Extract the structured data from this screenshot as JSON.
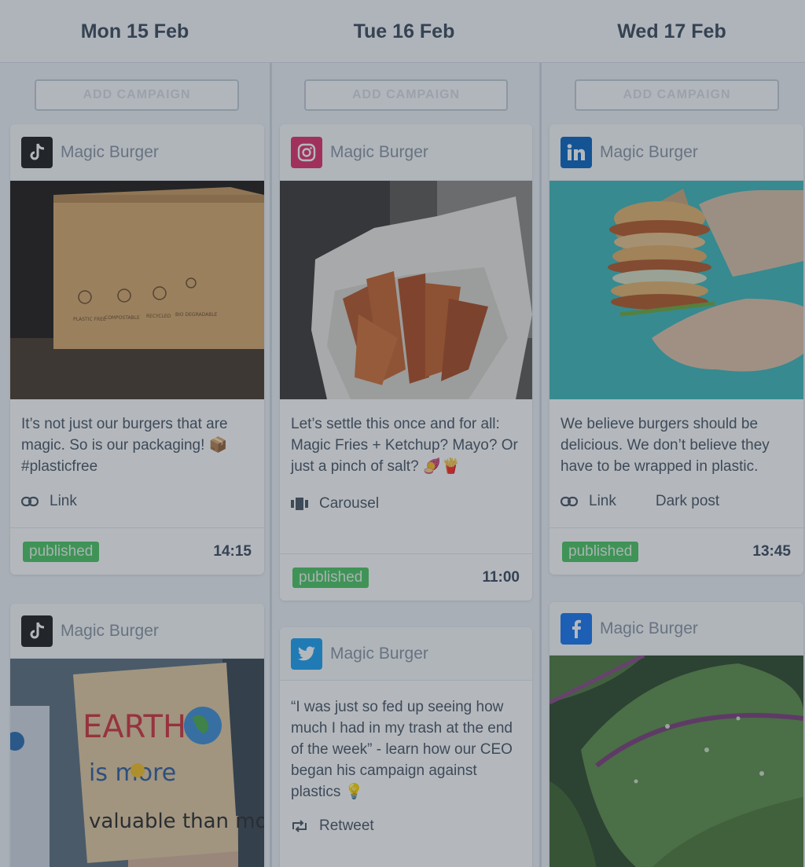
{
  "days": [
    "Mon 15 Feb",
    "Tue 16 Feb",
    "Wed 17 Feb"
  ],
  "add_campaign_label": "ADD CAMPAIGN",
  "account_name": "Magic Burger",
  "colors": {
    "published_badge": "#4cc761",
    "tiktok": "#1f1f1f",
    "instagram": "#e1306c",
    "linkedin": "#0a66c2",
    "twitter": "#1da1f2",
    "facebook": "#1877f2"
  },
  "posts": {
    "mon_1": {
      "network": "tiktok-icon",
      "caption": "It’s not just our burgers that are magic. So is our packaging! 📦#plasticfree",
      "meta": "Link",
      "status": "published",
      "time": "14:15",
      "image_text": [
        "PLASTIC FREE",
        "COMPOSTABLE",
        "RECYCLED",
        "BIO DEGRADABLE"
      ]
    },
    "mon_2": {
      "network": "tiktok-icon",
      "image_text": [
        "EARTH",
        "is more",
        "valuable than money"
      ]
    },
    "tue_1": {
      "network": "instagram-icon",
      "caption": "Let’s settle this once and for all: Magic Fries + Ketchup? Mayo? Or just a pinch of salt? 🍠🍟",
      "meta": "Carousel",
      "status": "published",
      "time": "11:00"
    },
    "tue_2": {
      "network": "twitter-icon",
      "caption": "“I was just so fed up seeing how much I had in my trash at the end of the week” - learn how our CEO began his campaign against plastics 💡",
      "meta": "Retweet"
    },
    "wed_1": {
      "network": "linkedin-icon",
      "caption": "We believe burgers should be delicious. We don’t believe they have to be wrapped in plastic.",
      "meta": "Link",
      "meta2": "Dark post",
      "status": "published",
      "time": "13:45"
    },
    "wed_2": {
      "network": "facebook-icon"
    }
  }
}
